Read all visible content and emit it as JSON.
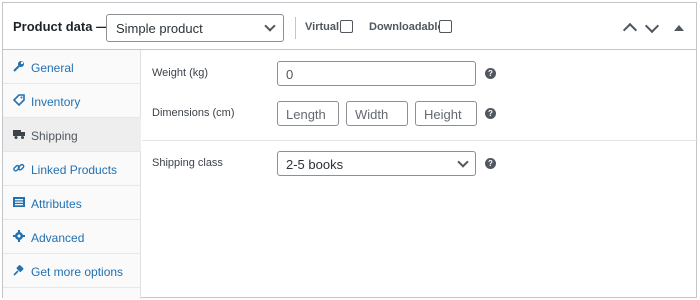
{
  "header": {
    "title": "Product data —",
    "product_type": "Simple product",
    "virtual_label": "Virtual:",
    "downloadable_label": "Downloadable:"
  },
  "sidebar": {
    "items": [
      {
        "label": "General",
        "icon": "wrench-icon"
      },
      {
        "label": "Inventory",
        "icon": "tag-icon"
      },
      {
        "label": "Shipping",
        "icon": "truck-icon",
        "active": true
      },
      {
        "label": "Linked Products",
        "icon": "link-icon"
      },
      {
        "label": "Attributes",
        "icon": "list-icon"
      },
      {
        "label": "Advanced",
        "icon": "gear-icon"
      },
      {
        "label": "Get more options",
        "icon": "plug-icon"
      }
    ]
  },
  "shipping": {
    "weight_label": "Weight (kg)",
    "weight_value": "0",
    "dimensions_label": "Dimensions (cm)",
    "length_placeholder": "Length",
    "width_placeholder": "Width",
    "height_placeholder": "Height",
    "shipping_class_label": "Shipping class",
    "shipping_class_value": "2-5 books",
    "help_glyph": "?"
  },
  "colors": {
    "link": "#2271b1",
    "border": "#c3c4c7",
    "active_tab_bg": "#eeeeee"
  }
}
